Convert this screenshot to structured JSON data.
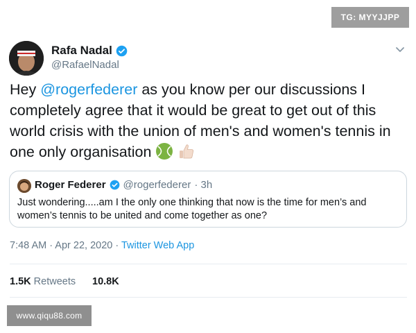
{
  "badge": {
    "text": "TG: MYYJJPP"
  },
  "tweet": {
    "author": {
      "name": "Rafa Nadal",
      "handle": "@RafaelNadal",
      "verified": true
    },
    "text_segments": {
      "intro": "Hey ",
      "mention": "@rogerfederer",
      "rest": " as you know per our discussions I completely agree that it would be great to get out of this world crisis with the union of men's and women's tennis in one only organisation"
    },
    "emojis": [
      "tennis-ball-emoji",
      "thumbs-up-emoji"
    ],
    "quoted": {
      "name": "Roger Federer",
      "handle": "@rogerfederer",
      "time": "· 3h",
      "verified": true,
      "text": "Just wondering.....am I the only one thinking that now is the time for men’s and women’s tennis to be united and come together as one?"
    },
    "meta": {
      "time": "7:48 AM · Apr 22, 2020 · ",
      "source": "Twitter Web App"
    },
    "stats": {
      "retweets_count": "1.5K",
      "retweets_label": "Retweets",
      "likes_count": "10.8K"
    }
  },
  "watermark": {
    "text": "www.qiqu88.com"
  },
  "colors": {
    "link": "#1b95e0",
    "secondary": "#657786",
    "verified": "#1da1f2",
    "border": "#ccd6dd"
  },
  "icons": {
    "verified": "verified-badge-icon",
    "menu": "chevron-down-icon"
  }
}
